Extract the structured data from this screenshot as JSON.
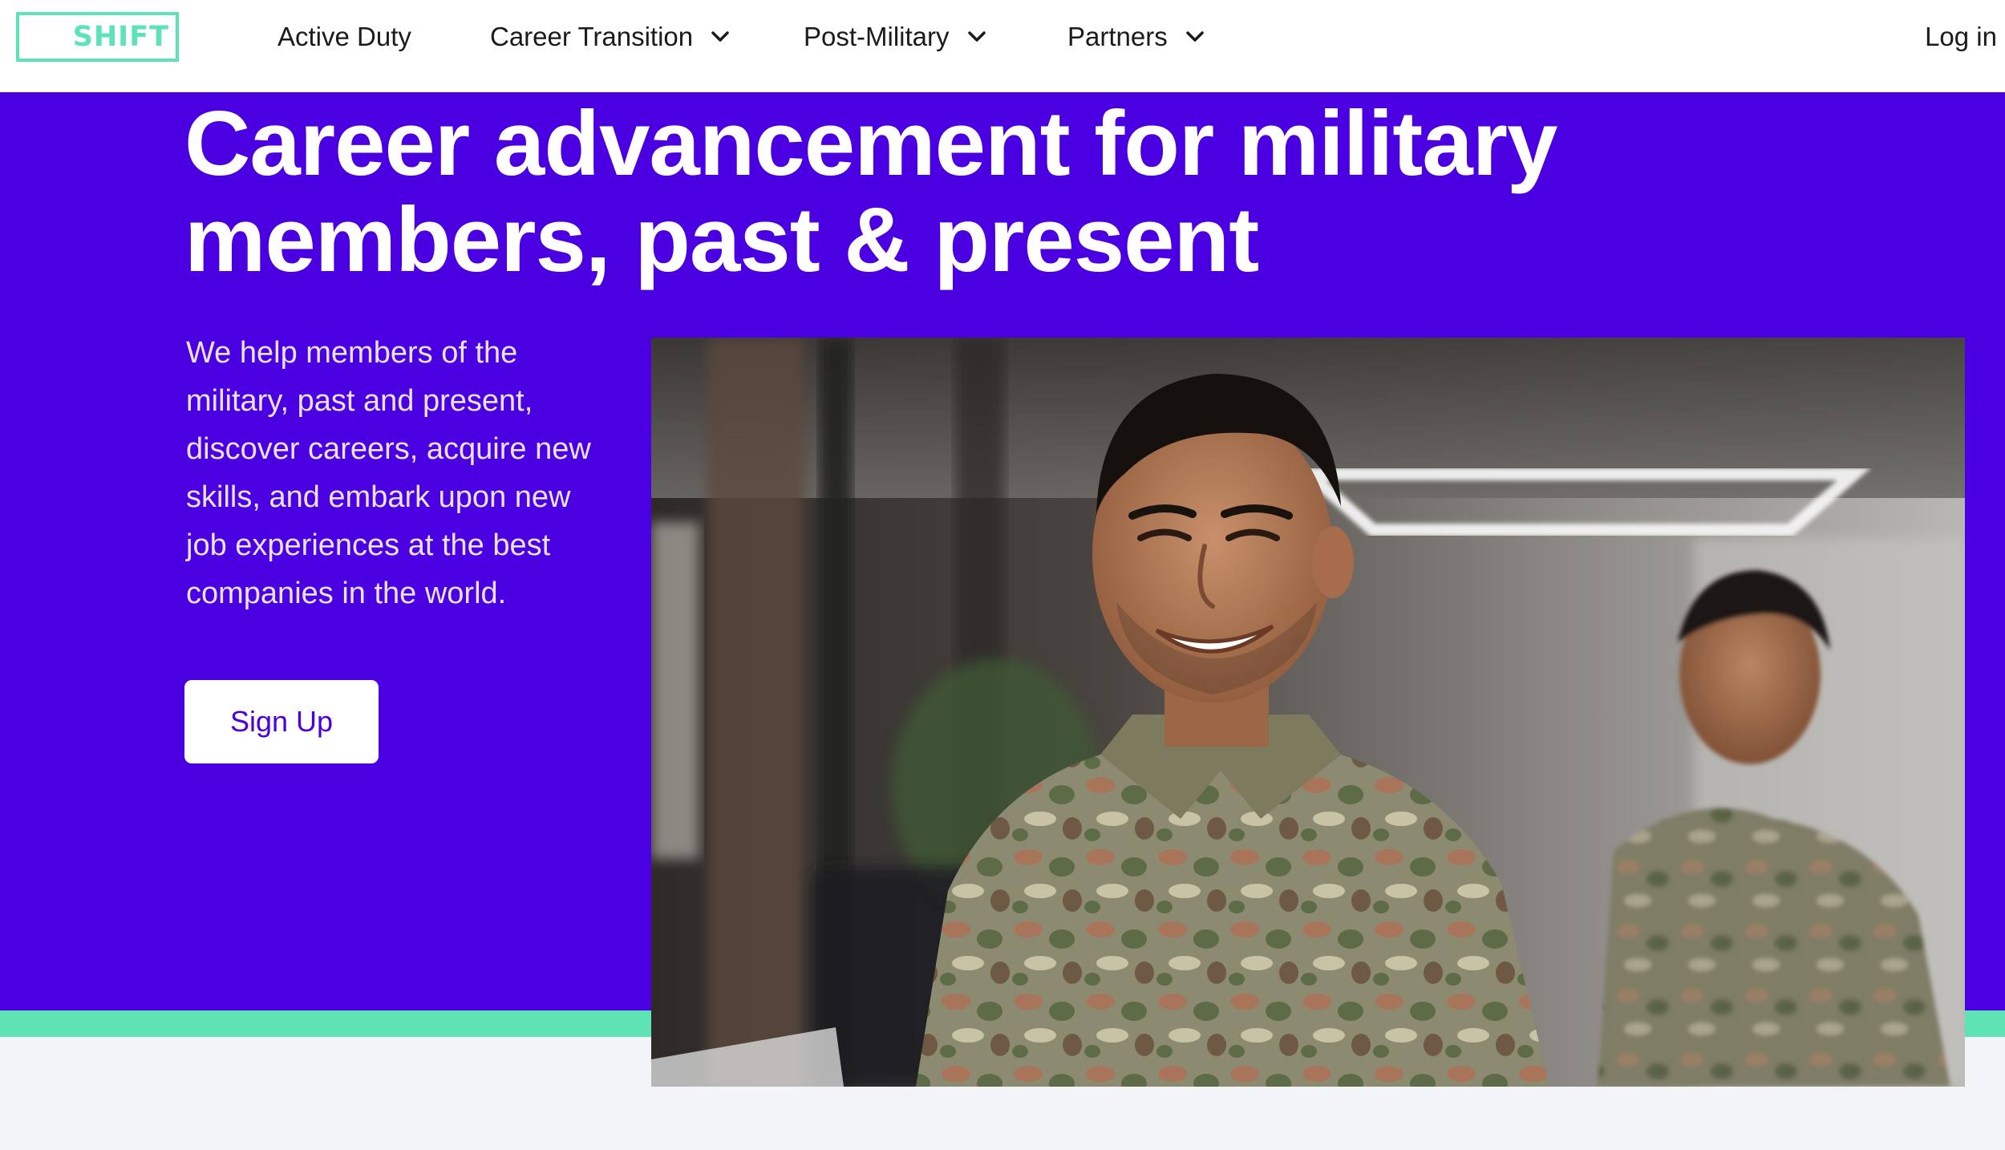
{
  "nav": {
    "logo_text": "SHIFT",
    "items": [
      {
        "label": "Active Duty",
        "has_dropdown": false
      },
      {
        "label": "Career Transition",
        "has_dropdown": true
      },
      {
        "label": "Post-Military",
        "has_dropdown": true
      },
      {
        "label": "Partners",
        "has_dropdown": true
      }
    ],
    "login_label": "Log in"
  },
  "hero": {
    "headline_line1": "Career advancement for military",
    "headline_line2": "members, past & present",
    "lead_lines": [
      "We help members of the",
      "military, past and present,",
      "discover careers, acquire new",
      "skills, and embark upon new",
      "job experiences at the best",
      "companies in the world."
    ],
    "cta_label": "Sign Up"
  },
  "colors": {
    "brand_purple": "#4a00e0",
    "accent_mint": "#5ee3b5",
    "page_background": "#f3f4f8"
  }
}
